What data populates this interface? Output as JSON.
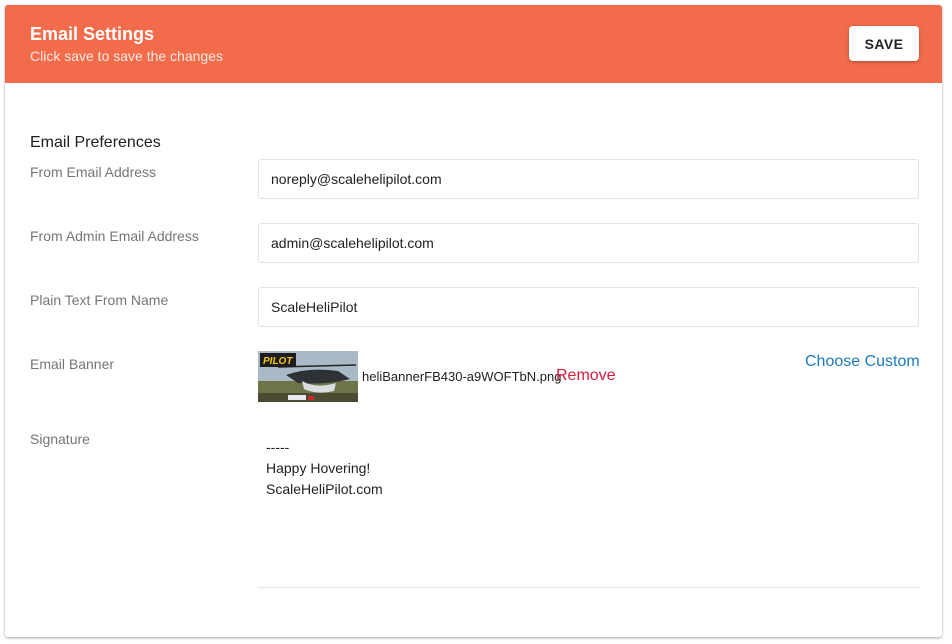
{
  "header": {
    "title": "Email Settings",
    "subtitle": "Click save to save the changes",
    "save_label": "SAVE",
    "color": "#f26b4a"
  },
  "preferences": {
    "section_title": "Email Preferences",
    "from_email": {
      "label": "From Email Address",
      "value": "noreply@scalehelipilot.com"
    },
    "admin_email": {
      "label": "From Admin Email Address",
      "value": "admin@scalehelipilot.com"
    },
    "plain_name": {
      "label": "Plain Text From Name",
      "value": "ScaleHeliPilot"
    },
    "banner": {
      "label": "Email Banner",
      "logo_text": "PILOT",
      "filename": "heliBannerFB430-a9WOFTbN.png",
      "remove_label": "Remove",
      "choose_label": "Choose Custom",
      "remove_color": "#d81b3c",
      "link_color": "#1b7bbf"
    },
    "signature": {
      "label": "Signature",
      "lines": [
        "-----",
        "Happy Hovering!",
        "ScaleHeliPilot.com"
      ]
    }
  }
}
